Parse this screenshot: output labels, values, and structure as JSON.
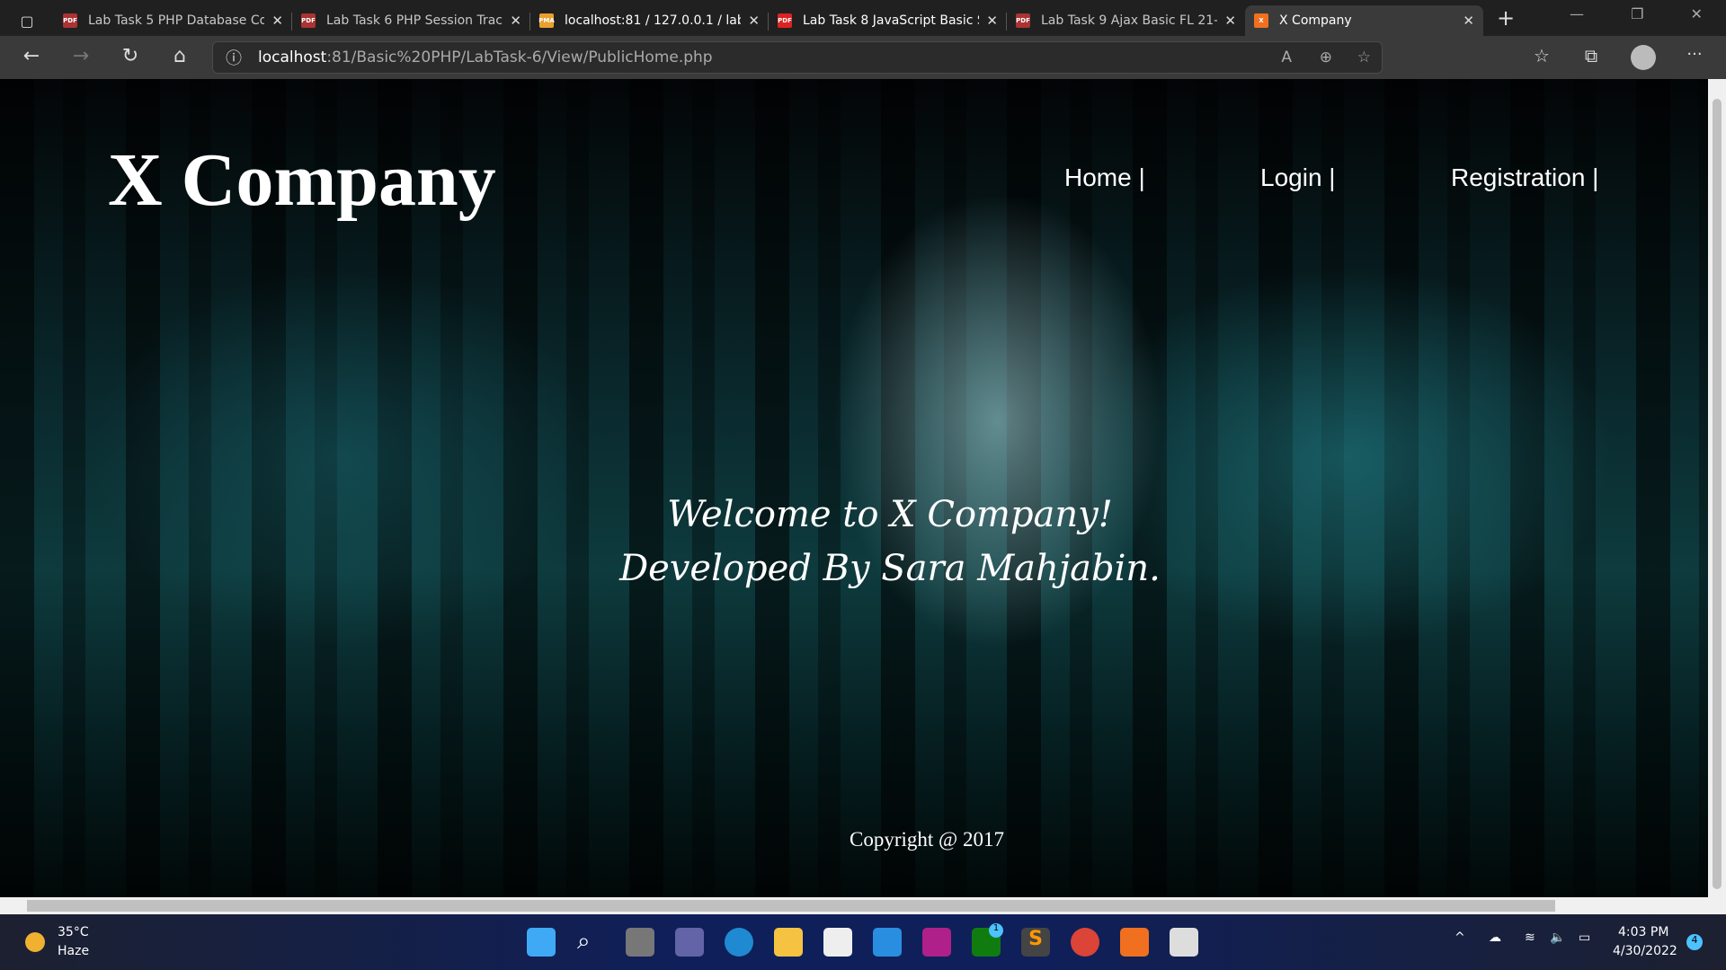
{
  "browser": {
    "tabs": [
      {
        "title": "Lab Task 5 PHP Database Co",
        "icon": "pdf-icon"
      },
      {
        "title": "Lab Task 6 PHP Session Trac",
        "icon": "pdf-icon"
      },
      {
        "title": "localhost:81 / 127.0.0.1 / lab",
        "icon": "phpmyadmin-icon"
      },
      {
        "title": "Lab Task 8 JavaScript Basic S",
        "icon": "pdf-icon"
      },
      {
        "title": "Lab Task 9 Ajax Basic FL 21-",
        "icon": "pdf-icon"
      },
      {
        "title": "X Company",
        "icon": "xampp-icon",
        "active": true
      }
    ],
    "url_host": "localhost",
    "url_rest": ":81/Basic%20PHP/LabTask-6/View/PublicHome.php"
  },
  "page": {
    "logo": "X Company",
    "nav": [
      "Home |",
      "Login |",
      "Registration |"
    ],
    "welcome_line1": "Welcome to X Company!",
    "welcome_line2": "Developed By Sara Mahjabin.",
    "copyright": "Copyright @ 2017"
  },
  "taskbar": {
    "weather_temp": "35°C",
    "weather_desc": "Haze",
    "time": "4:03 PM",
    "date": "4/30/2022",
    "notifications": "4",
    "xbox_badge": "1"
  }
}
